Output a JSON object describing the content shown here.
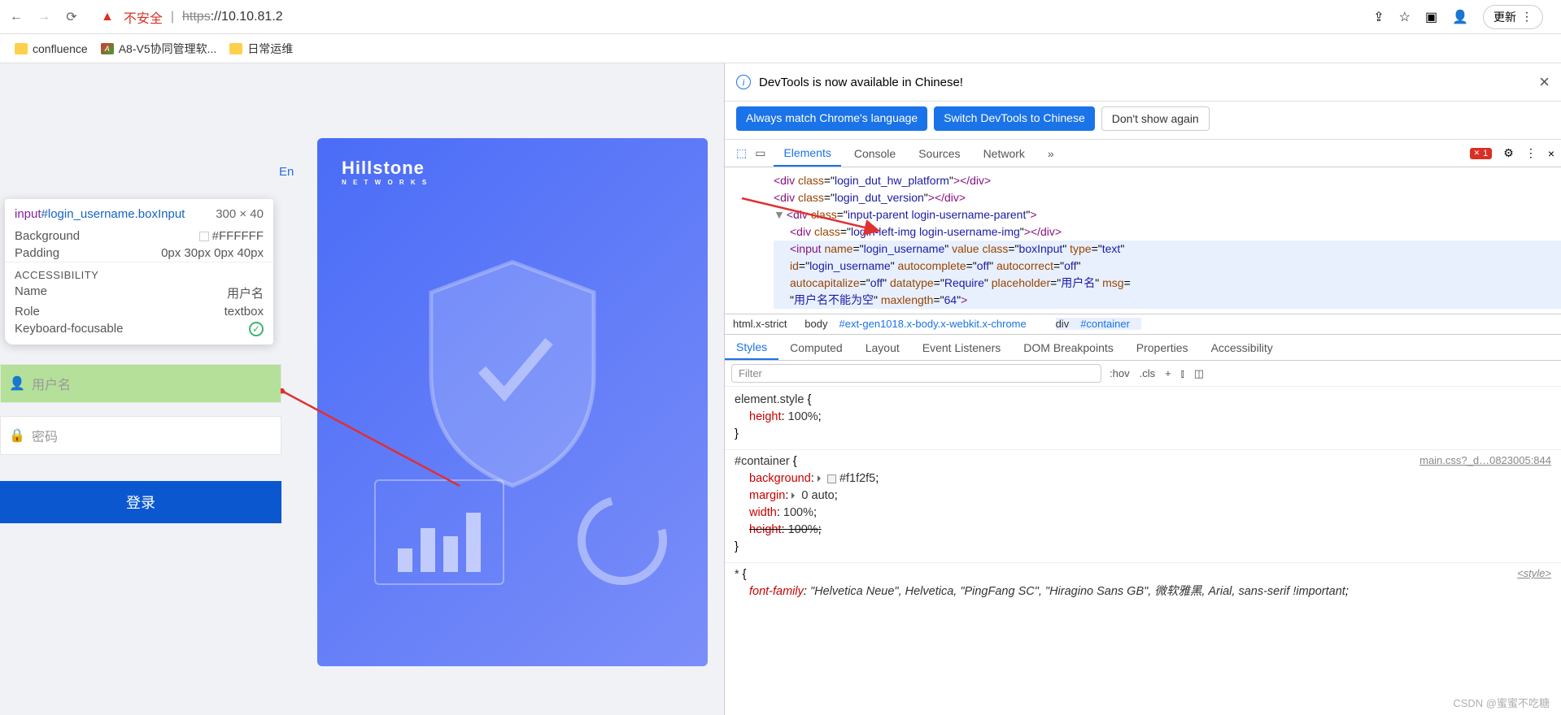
{
  "browser": {
    "insecure_label": "不安全",
    "url_scheme": "https",
    "url_rest": "://10.10.81.2",
    "update_label": "更新"
  },
  "bookmarks": {
    "confluence": "confluence",
    "a8v5": "A8-V5协同管理软...",
    "ops": "日常运维"
  },
  "tooltip": {
    "selector_tag": "input",
    "selector_id": "#login_username.boxInput",
    "dimensions": "300 × 40",
    "bg_label": "Background",
    "bg_value": "#FFFFFF",
    "pad_label": "Padding",
    "pad_value": "0px 30px 0px 40px",
    "acc_header": "ACCESSIBILITY",
    "name_label": "Name",
    "name_value": "用户名",
    "role_label": "Role",
    "role_value": "textbox",
    "kb_label": "Keyboard-focusable"
  },
  "login": {
    "lang": "En",
    "logo": "Hillstone",
    "logo_sub": "N E T W O R K S",
    "username_ph": "用户名",
    "password_ph": "密码",
    "submit": "登录"
  },
  "devtools": {
    "banner": "DevTools is now available in Chinese!",
    "btn_always": "Always match Chrome's language",
    "btn_switch": "Switch DevTools to Chinese",
    "btn_dont": "Don't show again",
    "tabs": {
      "elements": "Elements",
      "console": "Console",
      "sources": "Sources",
      "network": "Network"
    },
    "err_count": "1",
    "dom": {
      "l1": "login_dut_hw_platform",
      "l2": "login_dut_version",
      "l3": "input-parent login-username-parent",
      "l4": "login-left-img login-username-img",
      "input_name": "login_username",
      "input_class": "boxInput",
      "input_type": "text",
      "input_id": "login_username",
      "autocomplete": "off",
      "autocorrect": "off",
      "autocapitalize": "off",
      "datatype": "Require",
      "placeholder": "用户名",
      "msg": "用户名不能为空",
      "maxlength": "64"
    },
    "breadcrumb": {
      "b1": "html.x-strict",
      "b2_tag": "body",
      "b2_id": "#ext-gen1018.x-body.x-webkit.x-chrome",
      "b3_tag": "div",
      "b3_id": "#container"
    },
    "styles_tabs": {
      "styles": "Styles",
      "computed": "Computed",
      "layout": "Layout",
      "listeners": "Event Listeners",
      "dom_bp": "DOM Breakpoints",
      "properties": "Properties",
      "accessibility": "Accessibility"
    },
    "filter": {
      "placeholder": "Filter",
      "hov": ":hov",
      "cls": ".cls"
    },
    "rules": {
      "element_style": "element.style",
      "height": "height",
      "height_val": "100%",
      "container_sel": "#container",
      "container_link": "main.css?_d…0823005:844",
      "background": "background",
      "bg_val": "#f1f2f5",
      "margin": "margin",
      "margin_val": "0 auto",
      "width": "width",
      "width_val": "100%",
      "star_sel": "*",
      "star_src": "<style>",
      "ff": "font-family",
      "ff_val": "\"Helvetica Neue\", Helvetica, \"PingFang SC\", \"Hiragino Sans GB\", 微软雅黑, Arial, sans-serif !important"
    }
  },
  "watermark": "CSDN @蜜蜜不吃糖"
}
